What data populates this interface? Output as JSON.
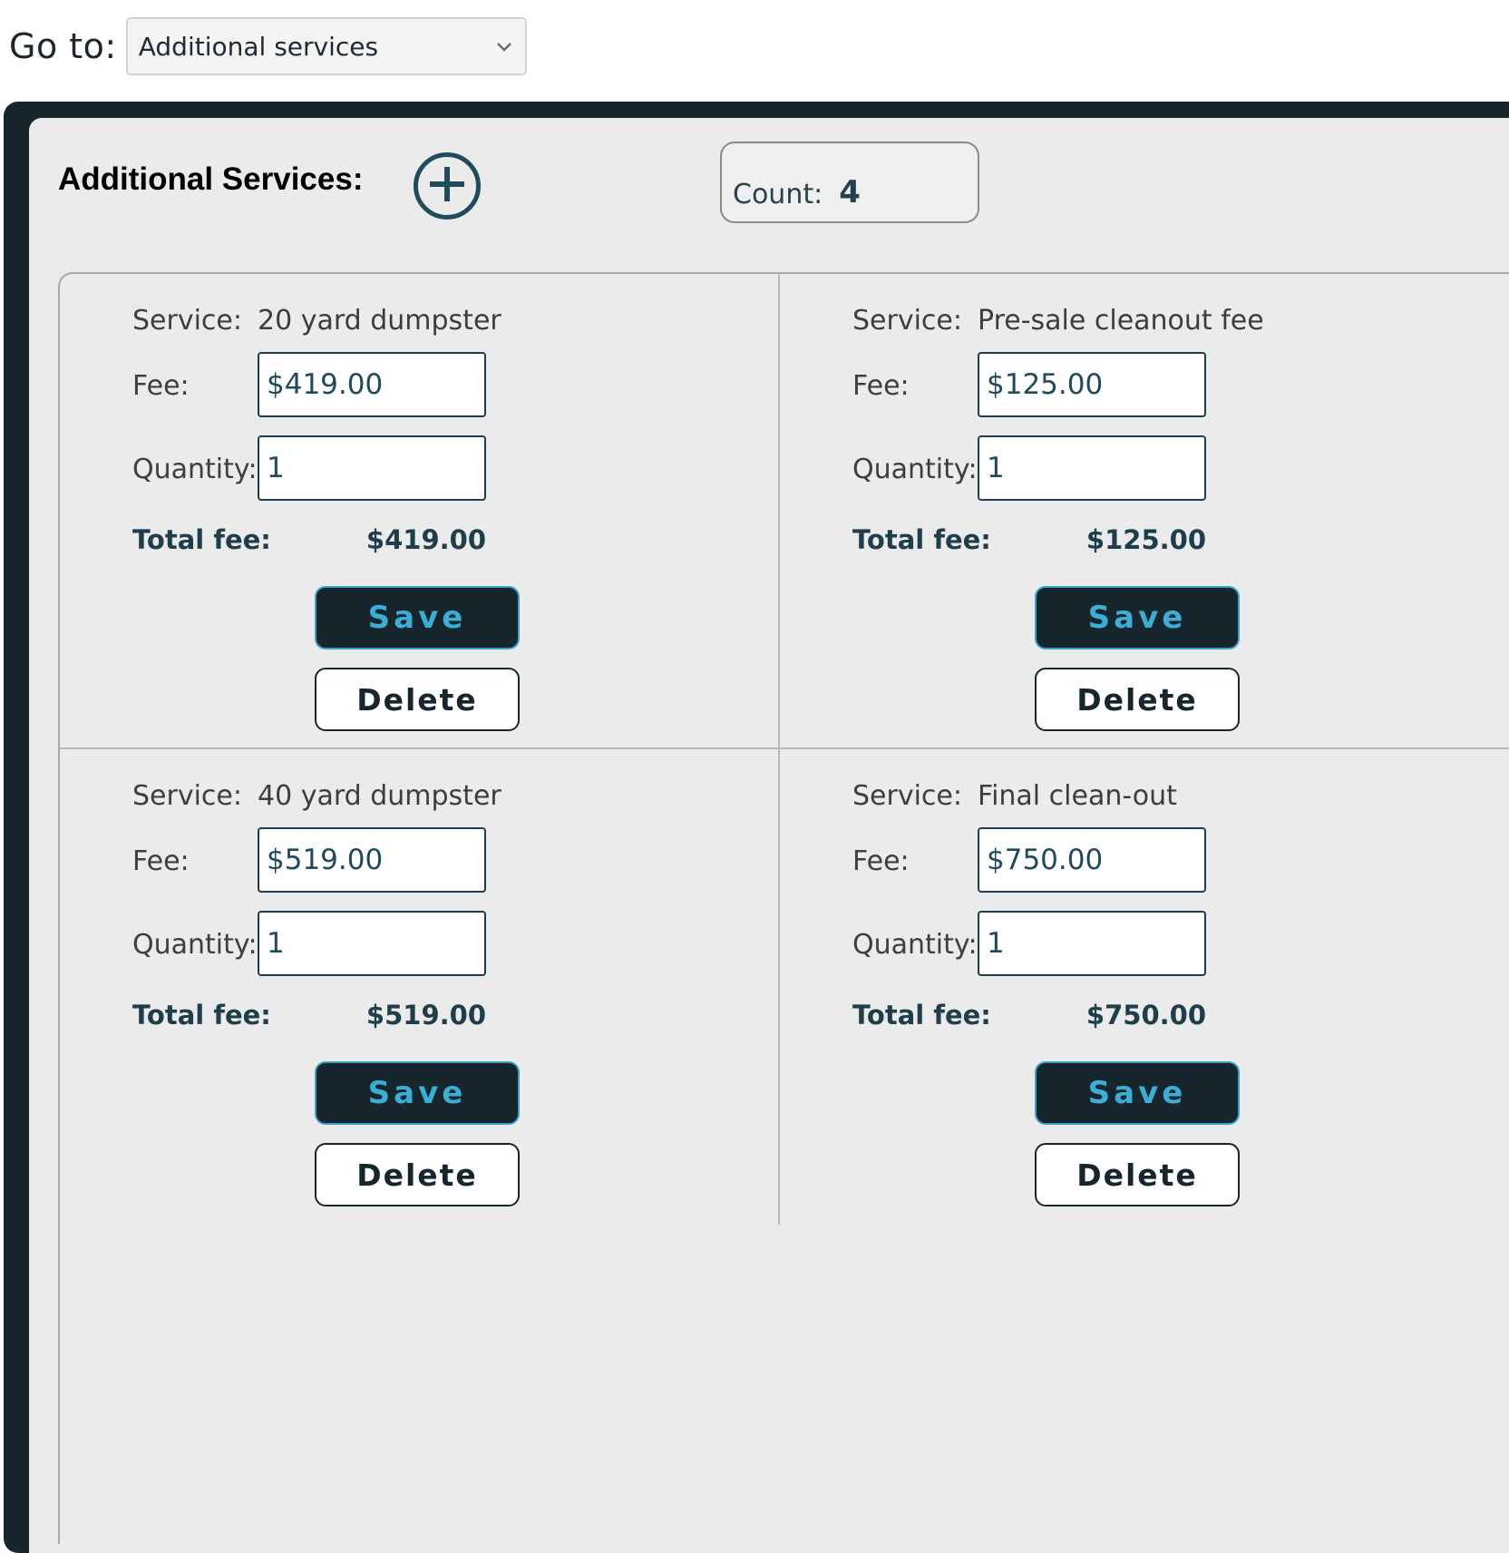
{
  "goto": {
    "label": "Go to:",
    "selected": "Additional services"
  },
  "panel": {
    "title": "Additional Services:",
    "count_label": "Count:",
    "count_value": "4"
  },
  "labels": {
    "service": "Service:",
    "fee": "Fee:",
    "quantity": "Quantity:",
    "total_fee": "Total fee:",
    "save": "Save",
    "delete": "Delete"
  },
  "services": [
    {
      "name": "20 yard dumpster",
      "fee": "$419.00",
      "quantity": "1",
      "total": "$419.00"
    },
    {
      "name": "Pre-sale cleanout fee",
      "fee": "$125.00",
      "quantity": "1",
      "total": "$125.00"
    },
    {
      "name": "40 yard dumpster",
      "fee": "$519.00",
      "quantity": "1",
      "total": "$519.00"
    },
    {
      "name": "Final clean-out",
      "fee": "$750.00",
      "quantity": "1",
      "total": "$750.00"
    }
  ],
  "colors": {
    "frame": "#17252d",
    "accent": "#3aaed4",
    "text_dark": "#1d3e4a",
    "panel_bg": "#ebebeb"
  },
  "icons": {
    "add": "plus-circle-icon",
    "dropdown": "chevron-down-icon"
  }
}
